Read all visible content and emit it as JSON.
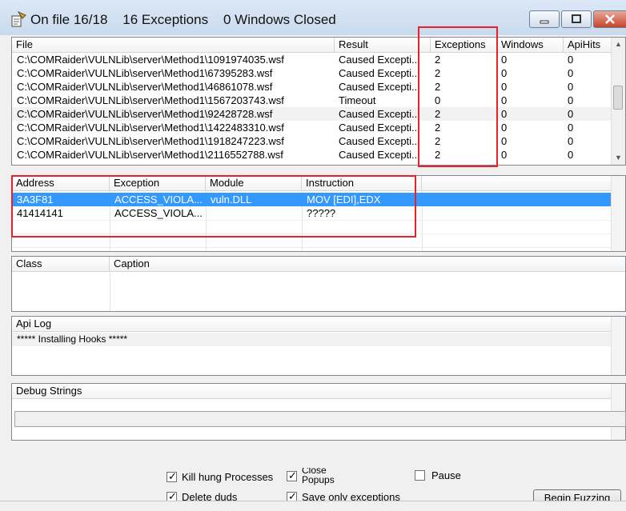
{
  "window": {
    "title": "On file 16/18    16 Exceptions    0 Windows Closed",
    "icon": "app-icon"
  },
  "files_table": {
    "columns": [
      "File",
      "Result",
      "Exceptions",
      "Windows",
      "ApiHits"
    ],
    "rows": [
      {
        "file": "C:\\COMRaider\\VULNLib\\server\\Method1\\1091974035.wsf",
        "result": "Caused Excepti...",
        "exceptions": "2",
        "windows": "0",
        "apihits": "0"
      },
      {
        "file": "C:\\COMRaider\\VULNLib\\server\\Method1\\67395283.wsf",
        "result": "Caused Excepti...",
        "exceptions": "2",
        "windows": "0",
        "apihits": "0"
      },
      {
        "file": "C:\\COMRaider\\VULNLib\\server\\Method1\\46861078.wsf",
        "result": "Caused Excepti...",
        "exceptions": "2",
        "windows": "0",
        "apihits": "0"
      },
      {
        "file": "C:\\COMRaider\\VULNLib\\server\\Method1\\1567203743.wsf",
        "result": "Timeout",
        "exceptions": "0",
        "windows": "0",
        "apihits": "0"
      },
      {
        "file": "C:\\COMRaider\\VULNLib\\server\\Method1\\92428728.wsf",
        "result": "Caused Excepti...",
        "exceptions": "2",
        "windows": "0",
        "apihits": "0"
      },
      {
        "file": "C:\\COMRaider\\VULNLib\\server\\Method1\\1422483310.wsf",
        "result": "Caused Excepti...",
        "exceptions": "2",
        "windows": "0",
        "apihits": "0"
      },
      {
        "file": "C:\\COMRaider\\VULNLib\\server\\Method1\\1918247223.wsf",
        "result": "Caused Excepti...",
        "exceptions": "2",
        "windows": "0",
        "apihits": "0"
      },
      {
        "file": "C:\\COMRaider\\VULNLib\\server\\Method1\\2116552788.wsf",
        "result": "Caused Excepti...",
        "exceptions": "2",
        "windows": "0",
        "apihits": "0"
      }
    ]
  },
  "exceptions_table": {
    "columns": [
      "Address",
      "Exception",
      "Module",
      "Instruction"
    ],
    "rows": [
      {
        "address": "3A3F81",
        "exception": "ACCESS_VIOLA...",
        "module": "vuln.DLL",
        "instruction": "MOV [EDI],EDX",
        "selected": true
      },
      {
        "address": "41414141",
        "exception": "ACCESS_VIOLA...",
        "module": "",
        "instruction": "?????",
        "selected": false
      }
    ]
  },
  "class_table": {
    "columns": [
      "Class",
      "Caption"
    ]
  },
  "api_log": {
    "header": "Api Log",
    "lines": [
      "***** Installing Hooks *****"
    ]
  },
  "debug_strings": {
    "header": "Debug Strings"
  },
  "options": {
    "kill_hung": {
      "label": "Kill hung Processes",
      "checked": true
    },
    "close_popups": {
      "label": "Close Popups",
      "checked": true
    },
    "pause": {
      "label": "Pause",
      "checked": false
    },
    "delete_duds": {
      "label": "Delete duds",
      "checked": true
    },
    "save_only_exceptions": {
      "label": "Save only exceptions",
      "checked": true
    }
  },
  "buttons": {
    "begin_fuzzing": "Begin Fuzzing"
  },
  "colors": {
    "selection": "#3399ff",
    "highlight_box": "#e8202a"
  }
}
